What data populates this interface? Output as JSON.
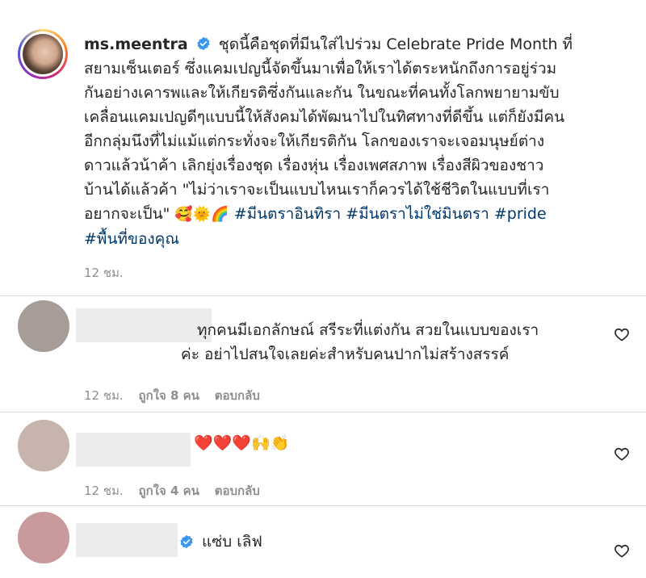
{
  "post": {
    "username": "ms.meentra",
    "caption_lines": [
      "ชุดนี้คือชุดที่มีนใส่ไปร่วม Celebrate Pride Month ที่",
      "สยามเซ็นเตอร์ ซึ่งแคมเปญนี้จัดขึ้นมาเพื่อให้เราได้ตระหนักถึงการอยู่ร่วม",
      "กันอย่างเคารพและให้เกียรติซึ่งกันและกัน ในขณะที่คนทั้งโลกพยายามขับ",
      "เคลื่อนแคมเปญดีๆแบบนี้ให้สังคมได้พัฒนาไปในทิศทางที่ดีขึ้น แต่ก็ยังมีคน",
      "อีกกลุ่มนึงที่ไม่แม้แต่กระทั่งจะให้เกียรติกัน โลกของเราจะเจอมนุษย์ต่าง",
      "ดาวแล้วน้าค้า เลิกยุ่งเรื่องชุด เรื่องหุ่น เรื่องเพศสภาพ เรื่องสีผิวของชาว",
      "บ้านได้แล้วค้า \"ไม่ว่าเราจะเป็นแบบไหนเราก็ควรได้ใช้ชีวิตในแบบที่เรา"
    ],
    "caption_last": "อยากจะเป็น\"",
    "emojis": "🥰🌞🌈",
    "hashtags_line1": "#มีนตราอินทิรา #มีนตราไม่ใช่มินตรา #pride",
    "hashtags_line2": "#พื้นที่ของคุณ",
    "time": "12 ชม."
  },
  "comments": [
    {
      "text_lines": [
        "ทุกคนมีเอกลักษณ์ สรีระที่แต่งกัน สวยในแบบของเรา",
        "ค่ะ อย่าไปสนใจเลยค่ะสำหรับคนปากไม่สร้างสรรค์"
      ],
      "time": "12 ชม.",
      "likes": "ถูกใจ 8 คน",
      "reply": "ตอบกลับ",
      "avatar_color": "#a89c98",
      "name_blur_color": "#ececec"
    },
    {
      "text_lines": [
        "❤️❤️❤️🙌👏"
      ],
      "time": "12 ชม.",
      "likes": "ถูกใจ 4 คน",
      "reply": "ตอบกลับ",
      "avatar_color": "#c7b5ad",
      "name_blur_color": "#ececec"
    },
    {
      "text_lines": [
        "แซ่บ เลิฟ"
      ],
      "avatar_color": "#c99a9c",
      "name_blur_color": "#ececec",
      "verified": true
    }
  ],
  "icons": {
    "verified": "verified-badge-icon",
    "like": "heart-outline-icon"
  },
  "colors": {
    "verified": "#3897f0",
    "hashtag": "#00376b",
    "muted": "#8e8e8e"
  }
}
